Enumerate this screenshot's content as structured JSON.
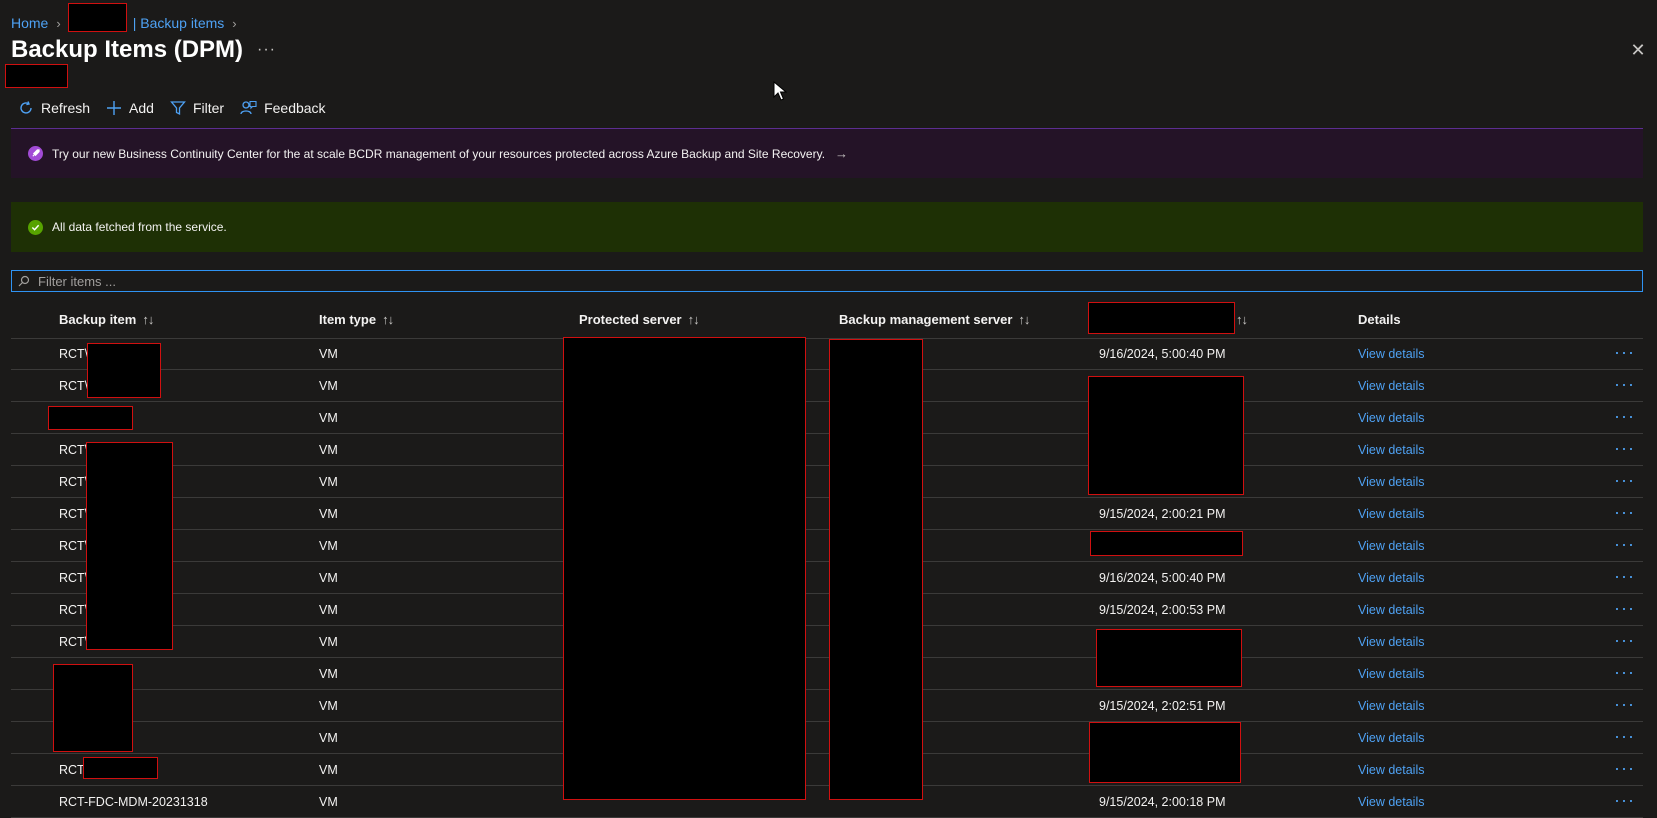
{
  "breadcrumb": {
    "home": "Home",
    "vault_suffix": "| Backup items",
    "sep": ">"
  },
  "title": "Backup Items (DPM)",
  "title_more": "···",
  "close": "✕",
  "toolbar": {
    "refresh": "Refresh",
    "add": "Add",
    "filter": "Filter",
    "feedback": "Feedback"
  },
  "banner": {
    "text": "Try our new Business Continuity Center for the at scale BCDR management of your resources protected across Azure Backup and Site Recovery.",
    "arrow": "→"
  },
  "status": {
    "text": "All data fetched from the service."
  },
  "filter": {
    "placeholder": "Filter items ..."
  },
  "table": {
    "columns": {
      "backup_item": "Backup item",
      "item_type": "Item type",
      "protected_server": "Protected server",
      "backup_mgmt_server": "Backup management server",
      "details": "Details",
      "sort_glyph": "↑↓"
    },
    "rows": [
      {
        "item": "RCT\\",
        "type": "VM",
        "time": "9/16/2024, 5:00:40 PM",
        "details": "View details"
      },
      {
        "item": "RCT\\",
        "type": "VM",
        "time": "",
        "details": "View details"
      },
      {
        "item": "",
        "type": "VM",
        "time": "",
        "details": "View details"
      },
      {
        "item": "RCT\\",
        "type": "VM",
        "time": "",
        "details": "View details"
      },
      {
        "item": "RCT\\",
        "type": "VM",
        "time": "",
        "details": "View details"
      },
      {
        "item": "RCT\\",
        "type": "VM",
        "time": "9/15/2024, 2:00:21 PM",
        "details": "View details"
      },
      {
        "item": "RCT\\",
        "type": "VM",
        "time": "",
        "details": "View details"
      },
      {
        "item": "RCT\\",
        "type": "VM",
        "time": "9/16/2024, 5:00:40 PM",
        "details": "View details"
      },
      {
        "item": "RCT\\",
        "type": "VM",
        "time": "9/15/2024, 2:00:53 PM",
        "details": "View details"
      },
      {
        "item": "RCT\\",
        "type": "VM",
        "time": "",
        "details": "View details"
      },
      {
        "item": "",
        "type": "VM",
        "time": "",
        "details": "View details"
      },
      {
        "item": "",
        "type": "VM",
        "time": "9/15/2024, 2:02:51 PM",
        "details": "View details"
      },
      {
        "item": "",
        "type": "VM",
        "time": "",
        "details": "View details"
      },
      {
        "item": "RCT\\",
        "type": "VM",
        "time": "",
        "details": "View details"
      },
      {
        "item": "RCT-FDC-MDM-20231318",
        "type": "VM",
        "time": "9/15/2024, 2:00:18 PM",
        "details": "View details"
      }
    ],
    "more_glyph": "···"
  },
  "colors": {
    "accent": "#4ea1f3",
    "banner_bg": "#241327",
    "success_bg": "#1e3005",
    "success_icon": "#57a300"
  }
}
